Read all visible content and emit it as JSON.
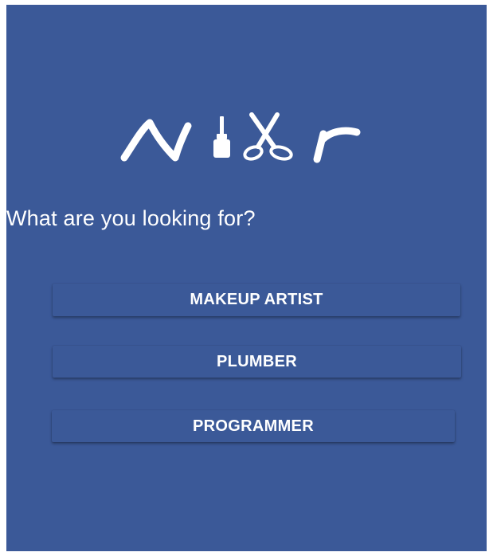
{
  "logo": {
    "name": "NiXr",
    "color": "#ffffff"
  },
  "prompt": {
    "question": "What are you looking for?"
  },
  "options": [
    {
      "label": "MAKEUP ARTIST"
    },
    {
      "label": "PLUMBER"
    },
    {
      "label": "PROGRAMMER"
    }
  ],
  "colors": {
    "background": "#3b5998",
    "text": "#ffffff"
  }
}
